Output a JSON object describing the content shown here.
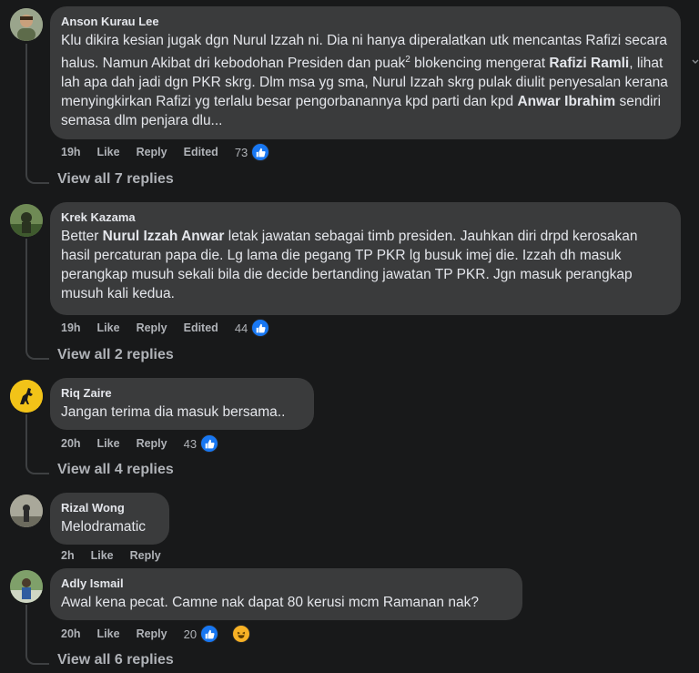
{
  "comments": [
    {
      "author": "Anson Kurau Lee",
      "text_html_parts": [
        {
          "t": "Klu dikira kesian jugak dgn Nurul Izzah ni. Dia ni hanya diperalatkan utk mencantas Rafizi secara halus. Namun Akibat dri kebodohan Presiden dan puak"
        },
        {
          "sup": "2"
        },
        {
          "t": " blokencing mengerat "
        },
        {
          "b": "Rafizi Ramli"
        },
        {
          "t": ", lihat lah apa dah jadi dgn PKR skrg. Dlm msa yg sma, Nurul Izzah skrg pulak diulit penyesalan kerana menyingkirkan Rafizi yg terlalu besar pengorbanannya kpd parti dan kpd "
        },
        {
          "b": "Anwar Ibrahim"
        },
        {
          "t": " sendiri semasa dlm penjara dlu..."
        }
      ],
      "time": "19h",
      "like": "Like",
      "reply": "Reply",
      "edited": "Edited",
      "reactions": "73",
      "view_replies": "View all 7 replies"
    },
    {
      "author": "Krek Kazama",
      "text_html_parts": [
        {
          "t": "Better "
        },
        {
          "b": "Nurul Izzah Anwar"
        },
        {
          "t": " letak jawatan sebagai timb presiden. Jauhkan diri drpd kerosakan hasil percaturan papa die. Lg lama die pegang TP PKR lg busuk imej die. Izzah dh masuk perangkap musuh sekali bila die decide bertanding jawatan TP PKR. Jgn masuk perangkap musuh kali kedua."
        }
      ],
      "time": "19h",
      "like": "Like",
      "reply": "Reply",
      "edited": "Edited",
      "reactions": "44",
      "view_replies": "View all 2 replies"
    },
    {
      "author": "Riq Zaire",
      "text_html_parts": [
        {
          "t": "Jangan terima dia masuk bersama.."
        }
      ],
      "time": "20h",
      "like": "Like",
      "reply": "Reply",
      "reactions": "43",
      "view_replies": "View all 4 replies"
    },
    {
      "author": "Rizal Wong",
      "text_html_parts": [
        {
          "t": "Melodramatic"
        }
      ],
      "time": "2h",
      "like": "Like",
      "reply": "Reply"
    },
    {
      "author": "Adly Ismail",
      "text_html_parts": [
        {
          "t": "Awal kena pecat. Camne nak dapat 80 kerusi mcm Ramanan nak?"
        }
      ],
      "time": "20h",
      "like": "Like",
      "reply": "Reply",
      "reactions": "20",
      "view_replies": "View all 6 replies"
    }
  ],
  "colors": {
    "background": "#18191a",
    "bubble": "#3a3b3c",
    "like_blue": "#1877f2",
    "secondary_text": "#b0b3b8"
  },
  "icons": [
    "avatar",
    "like-reaction-icon",
    "haha-reaction-icon"
  ]
}
